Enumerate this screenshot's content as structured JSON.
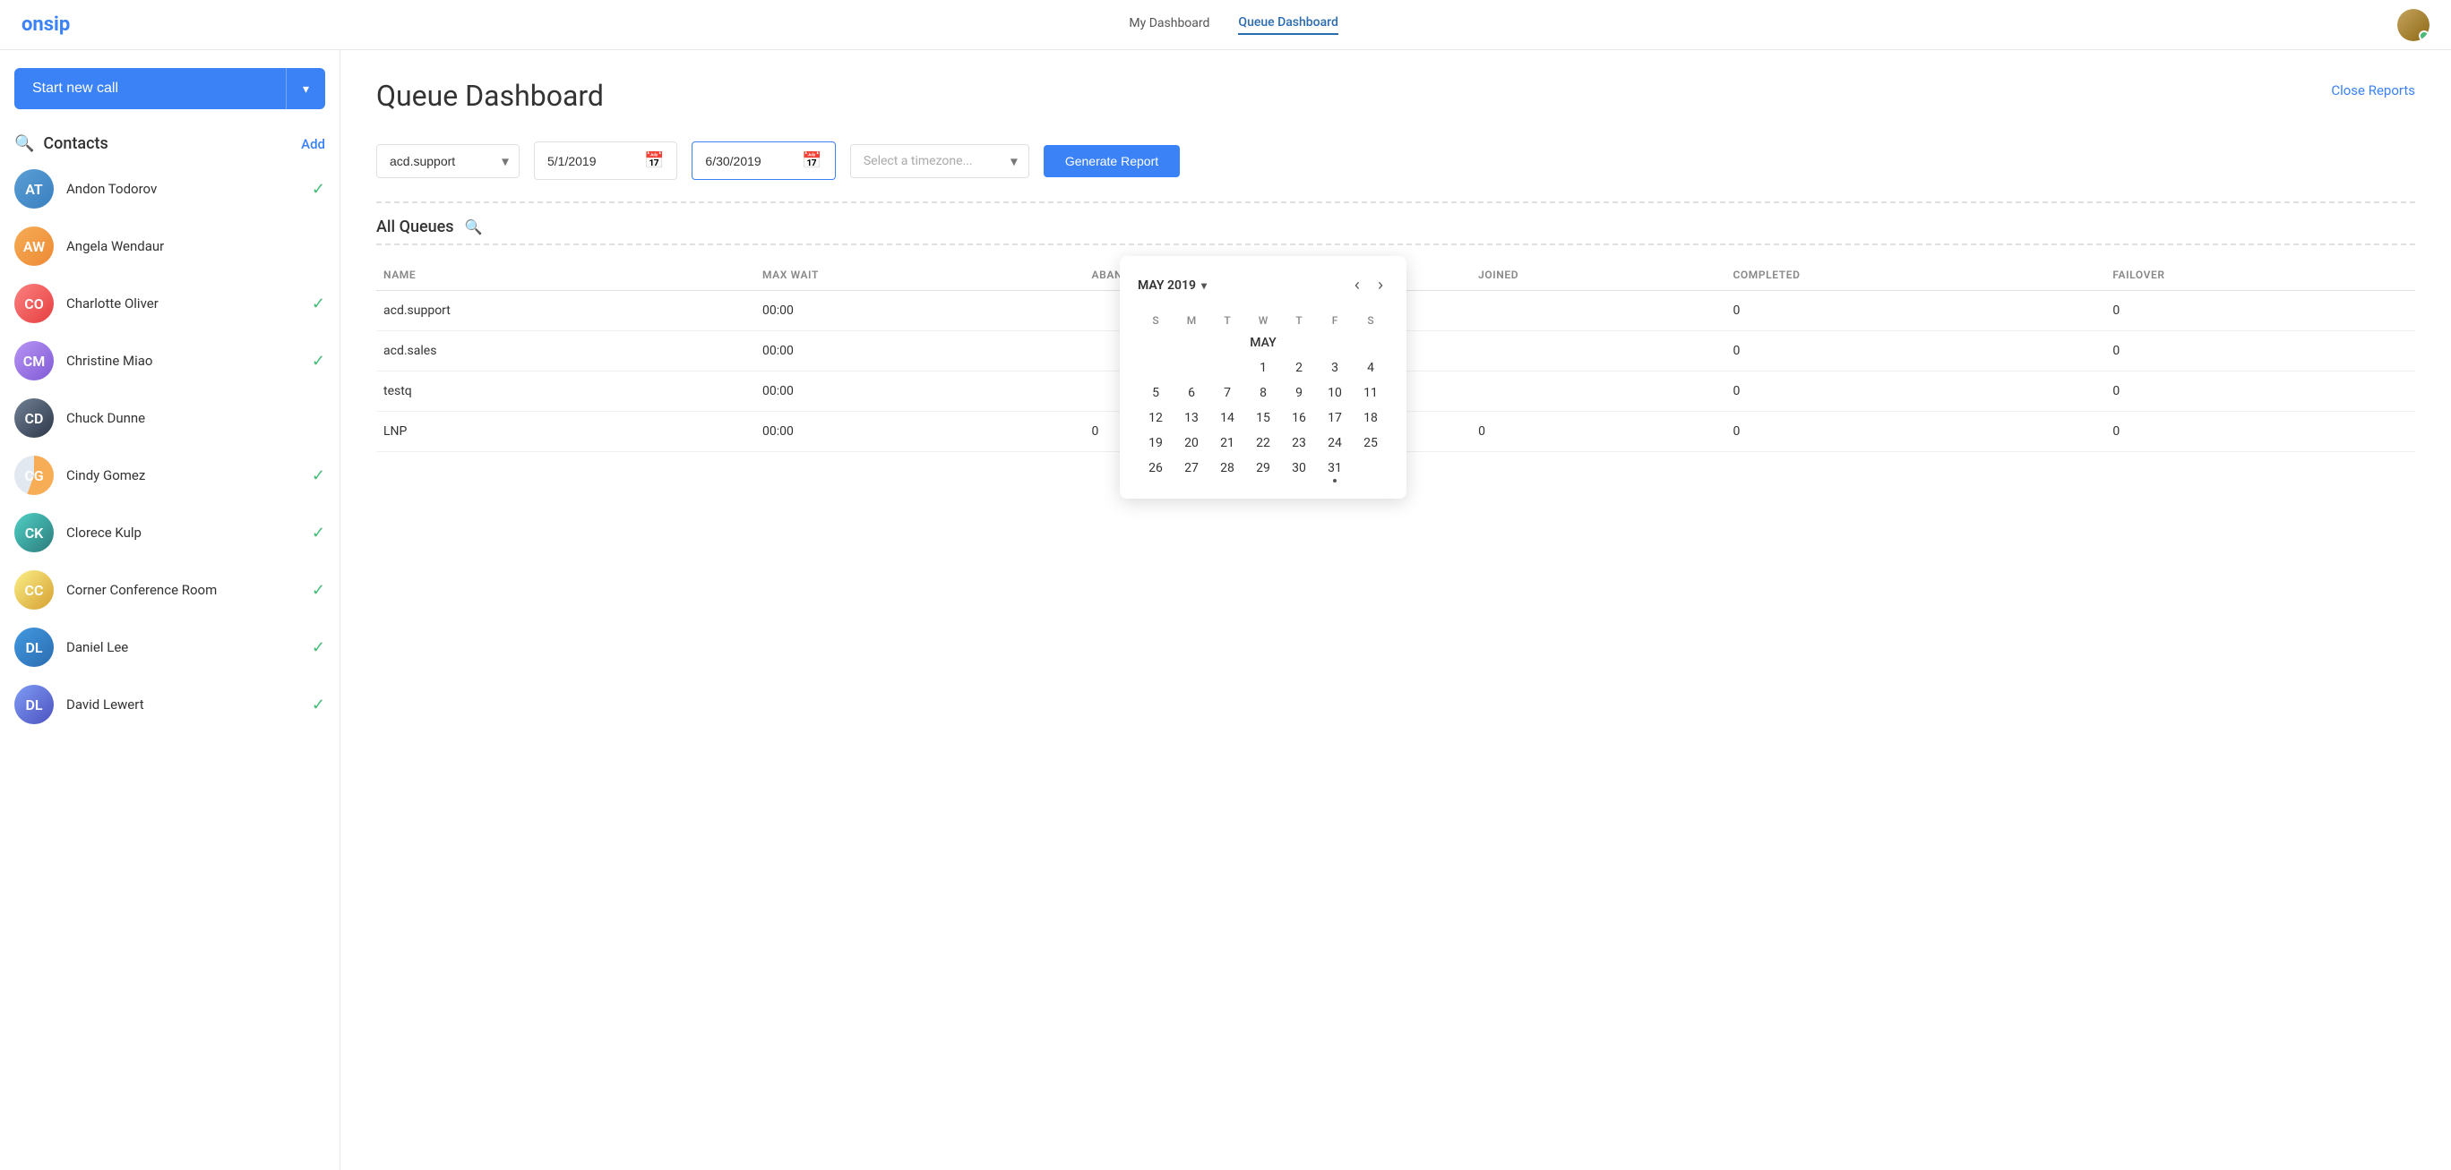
{
  "header": {
    "logo": "onsip",
    "nav": [
      {
        "label": "My Dashboard",
        "active": false
      },
      {
        "label": "Queue Dashboard",
        "active": true
      }
    ]
  },
  "sidebar": {
    "start_call_label": "Start new call",
    "start_call_arrow": "▾",
    "contacts_title": "Contacts",
    "add_label": "Add",
    "contacts": [
      {
        "name": "Andon Todorov",
        "initials": "AT",
        "color": "av-blue",
        "online": true
      },
      {
        "name": "Angela Wendaur",
        "initials": "AW",
        "color": "av-orange",
        "online": false
      },
      {
        "name": "Charlotte Oliver",
        "initials": "CO",
        "color": "av-red",
        "online": true
      },
      {
        "name": "Christine Miao",
        "initials": "CM",
        "color": "av-purple",
        "online": true
      },
      {
        "name": "Chuck Dunne",
        "initials": "CD",
        "color": "av-dark",
        "online": false
      },
      {
        "name": "Cindy Gomez",
        "initials": "CG",
        "color": "av-pie",
        "online": true
      },
      {
        "name": "Clorece Kulp",
        "initials": "CK",
        "color": "av-teal",
        "online": true
      },
      {
        "name": "Corner Conference Room",
        "initials": "CC",
        "color": "av-yellow",
        "online": true
      },
      {
        "name": "Daniel Lee",
        "initials": "DL",
        "color": "av-globe",
        "online": true
      },
      {
        "name": "David Lewert",
        "initials": "DL",
        "color": "av-indigo",
        "online": true
      }
    ]
  },
  "main": {
    "page_title": "Queue Dashboard",
    "close_reports_label": "Close Reports",
    "filter": {
      "queue_value": "acd.support",
      "start_date": "5/1/2019",
      "end_date": "6/30/2019",
      "timezone_placeholder": "Select a timezone...",
      "generate_label": "Generate Report"
    },
    "all_queues_label": "All Queues",
    "table": {
      "columns": [
        "NAME",
        "MAX WAIT",
        "ABANDONED",
        "JOINED",
        "COMPLETED",
        "FAILOVER"
      ],
      "rows": [
        {
          "name": "acd.support",
          "max_wait": "00:00",
          "abandoned": "",
          "joined": "",
          "completed": "0",
          "failover": "0"
        },
        {
          "name": "acd.sales",
          "max_wait": "00:00",
          "abandoned": "",
          "joined": "",
          "completed": "0",
          "failover": "0"
        },
        {
          "name": "testq",
          "max_wait": "00:00",
          "abandoned": "",
          "joined": "",
          "completed": "0",
          "failover": "0"
        },
        {
          "name": "LNP",
          "max_wait": "00:00",
          "abandoned": "0",
          "joined": "0",
          "completed": "0",
          "failover": "0"
        }
      ]
    }
  },
  "calendar": {
    "month_label": "MAY 2019",
    "day_headers": [
      "S",
      "M",
      "T",
      "W",
      "T",
      "F",
      "S"
    ],
    "section_label": "MAY",
    "weeks": [
      [
        null,
        null,
        null,
        "1",
        "2",
        "3",
        "4"
      ],
      [
        "5",
        "6",
        "7",
        "8",
        "9",
        "10",
        "11"
      ],
      [
        "12",
        "13",
        "14",
        "15",
        "16",
        "17",
        "18"
      ],
      [
        "19",
        "20",
        "21",
        "22",
        "23",
        "24",
        "25"
      ],
      [
        "26",
        "27",
        "28",
        "29",
        "30",
        "31",
        null
      ]
    ],
    "prev_nav": "‹",
    "next_nav": "›"
  }
}
